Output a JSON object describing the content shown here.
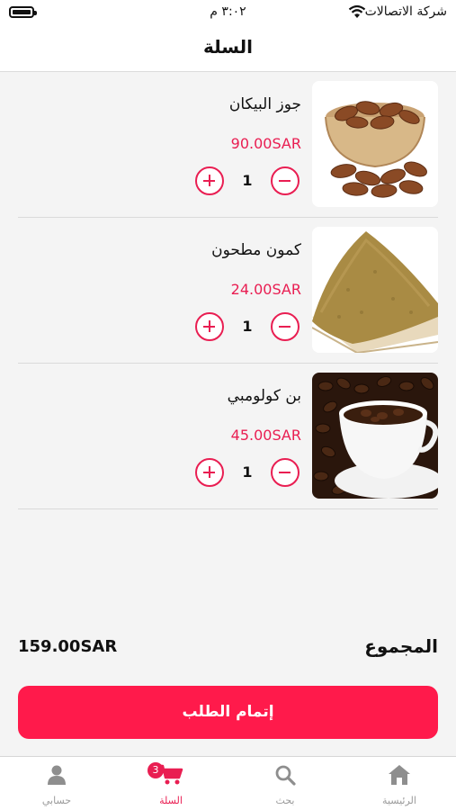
{
  "status_bar": {
    "carrier": "شركة الاتصالات",
    "time": "٣:٠٢ م"
  },
  "header": {
    "title": "السلة"
  },
  "cart": {
    "items": [
      {
        "name": "جوز البيكان",
        "price": "90.00SAR",
        "quantity": "1",
        "image_icon": "pecan-nuts-photo"
      },
      {
        "name": "كمون مطحون",
        "price": "24.00SAR",
        "quantity": "1",
        "image_icon": "ground-cumin-photo"
      },
      {
        "name": "بن كولومبي",
        "price": "45.00SAR",
        "quantity": "1",
        "image_icon": "coffee-beans-photo"
      }
    ]
  },
  "summary": {
    "total_label": "المجموع",
    "total_value": "159.00SAR"
  },
  "checkout": {
    "label": "إتمام الطلب"
  },
  "tabs": [
    {
      "label": "الرئيسية",
      "icon": "home-icon"
    },
    {
      "label": "بحث",
      "icon": "search-icon"
    },
    {
      "label": "السلة",
      "icon": "cart-icon",
      "badge": "3",
      "active": true
    },
    {
      "label": "حسابي",
      "icon": "user-icon"
    }
  ],
  "colors": {
    "accent": "#e91e52",
    "button": "#ff1a4b",
    "inactive_tab": "#9a9a9a"
  }
}
